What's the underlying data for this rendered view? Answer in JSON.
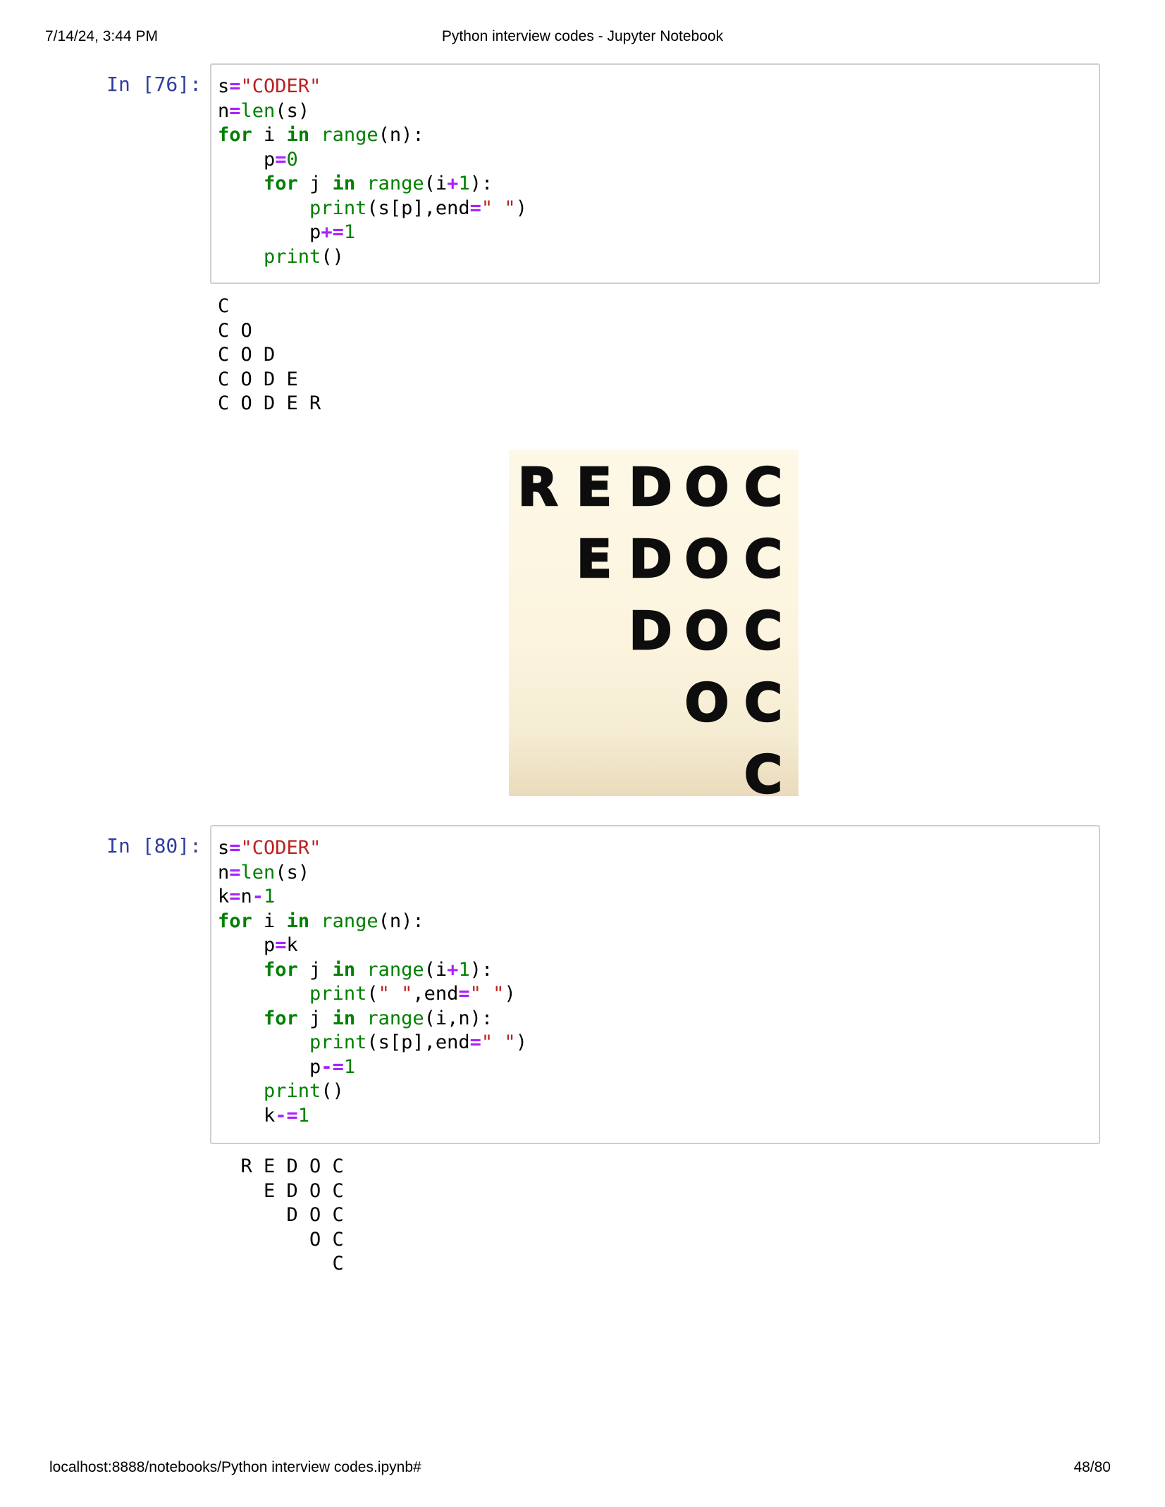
{
  "header": {
    "timestamp": "7/14/24, 3:44 PM",
    "title": "Python interview codes - Jupyter Notebook"
  },
  "footer": {
    "url": "localhost:8888/notebooks/Python interview codes.ipynb#",
    "page": "48/80"
  },
  "cells": [
    {
      "prompt": "In [76]:",
      "code": [
        "s=\"CODER\"",
        "n=len(s)",
        "for i in range(n):",
        "    p=0",
        "    for j in range(i+1):",
        "        print(s[p],end=\" \")",
        "        p+=1",
        "    print()"
      ],
      "output": "C \nC O \nC O D \nC O D E \nC O D E R "
    },
    {
      "prompt": "In [80]:",
      "code": [
        "s=\"CODER\"",
        "n=len(s)",
        "k=n-1",
        "for i in range(n):",
        "    p=k",
        "    for j in range(i+1):",
        "        print(\" \",end=\" \")",
        "    for j in range(i,n):",
        "        print(s[p],end=\" \")",
        "        p-=1",
        "    print()",
        "    k-=1"
      ],
      "output": "  R E D O C \n    E D O C \n      D O C \n        O C \n          C "
    }
  ],
  "pattern_image": {
    "rows": [
      "REDOC",
      "EDOC",
      "DOC",
      "OC",
      "C"
    ]
  }
}
